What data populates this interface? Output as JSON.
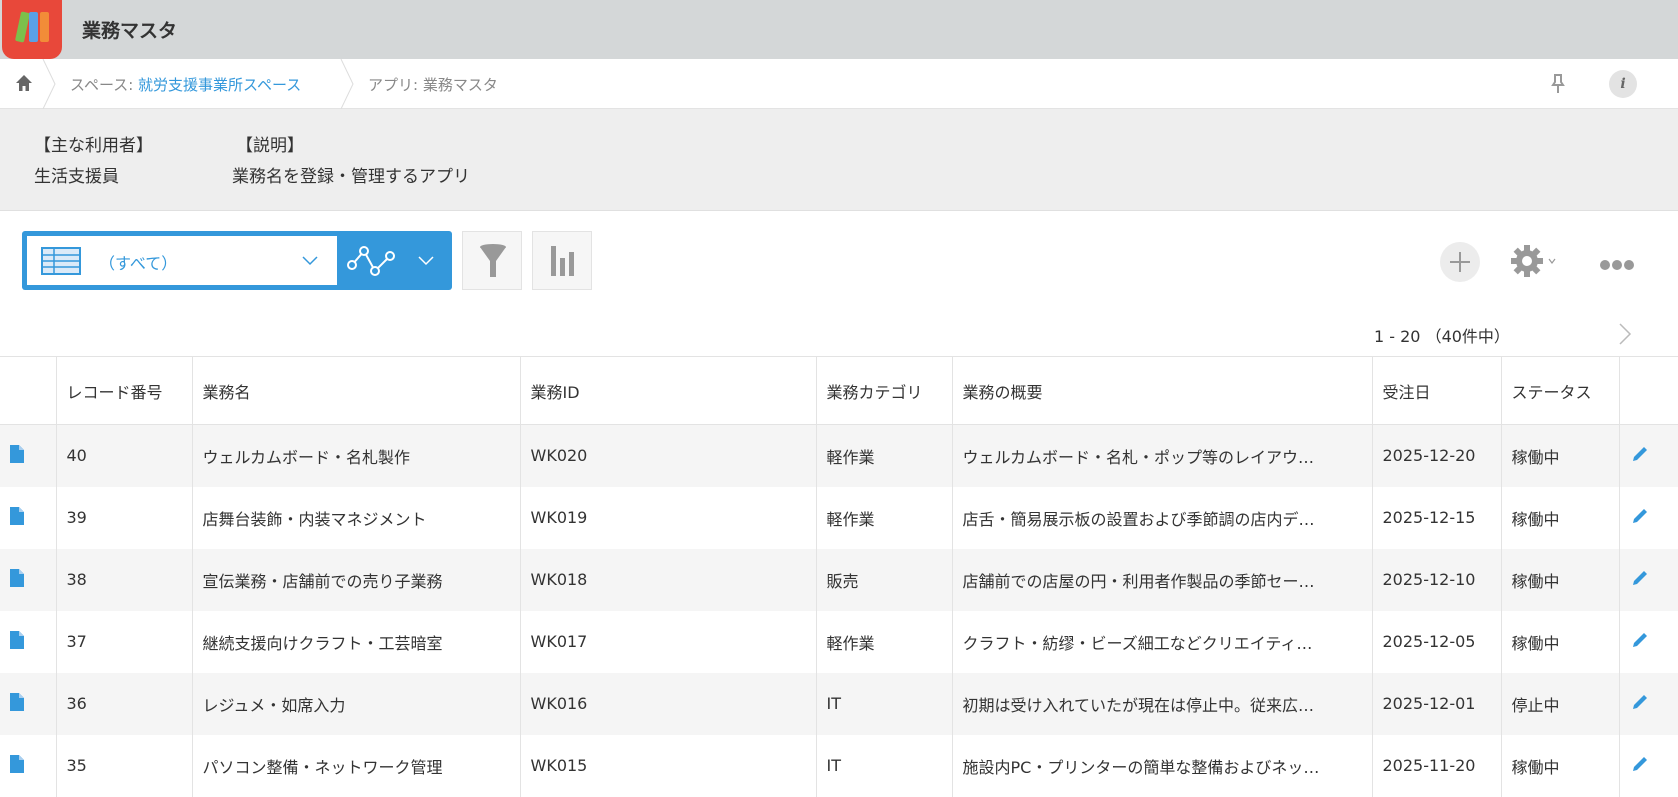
{
  "app": {
    "title": "業務マスタ"
  },
  "breadcrumb": {
    "space_prefix": "スペース: ",
    "space_name": "就労支援事業所スペース",
    "app_label": "アプリ: 業務マスタ"
  },
  "description": {
    "users_heading": "【主な利用者】",
    "users_value": "生活支援員",
    "desc_heading": "【説明】",
    "desc_value": "業務名を登録・管理するアプリ"
  },
  "toolbar": {
    "view_label": "（すべて）"
  },
  "pagination": {
    "text": "1 - 20 （40件中）"
  },
  "colors": {
    "accent": "#3498db",
    "header_bg": "#d4d7d8"
  },
  "table": {
    "columns": [
      "",
      "レコード番号",
      "業務名",
      "業務ID",
      "業務カテゴリ",
      "業務の概要",
      "受注日",
      "ステータス",
      ""
    ],
    "rows": [
      {
        "no": "40",
        "name": "ウェルカムボード・名札製作",
        "id": "WK020",
        "cat": "軽作業",
        "summary": "ウェルカムボード・名札・ポップ等のレイアウ…",
        "date": "2025-12-20",
        "status": "稼働中"
      },
      {
        "no": "39",
        "name": "店舞台装飾・内装マネジメント",
        "id": "WK019",
        "cat": "軽作業",
        "summary": "店舌・簡易展示板の設置および季節調の店内デ…",
        "date": "2025-12-15",
        "status": "稼働中"
      },
      {
        "no": "38",
        "name": "宣伝業務・店舗前での売り子業務",
        "id": "WK018",
        "cat": "販売",
        "summary": "店舗前での店屋の円・利用者作製品の季節セー…",
        "date": "2025-12-10",
        "status": "稼働中"
      },
      {
        "no": "37",
        "name": "継続支援向けクラフト・工芸暗室",
        "id": "WK017",
        "cat": "軽作業",
        "summary": "クラフト・紡缪・ビーズ細工などクリエイティ…",
        "date": "2025-12-05",
        "status": "稼働中"
      },
      {
        "no": "36",
        "name": "レジュメ・如席入力",
        "id": "WK016",
        "cat": "IT",
        "summary": "初期は受け入れていたが現在は停止中。従来広…",
        "date": "2025-12-01",
        "status": "停止中"
      },
      {
        "no": "35",
        "name": "パソコン整備・ネットワーク管理",
        "id": "WK015",
        "cat": "IT",
        "summary": "施設内PC・プリンターの簡単な整備およびネッ…",
        "date": "2025-11-20",
        "status": "稼働中"
      }
    ]
  }
}
